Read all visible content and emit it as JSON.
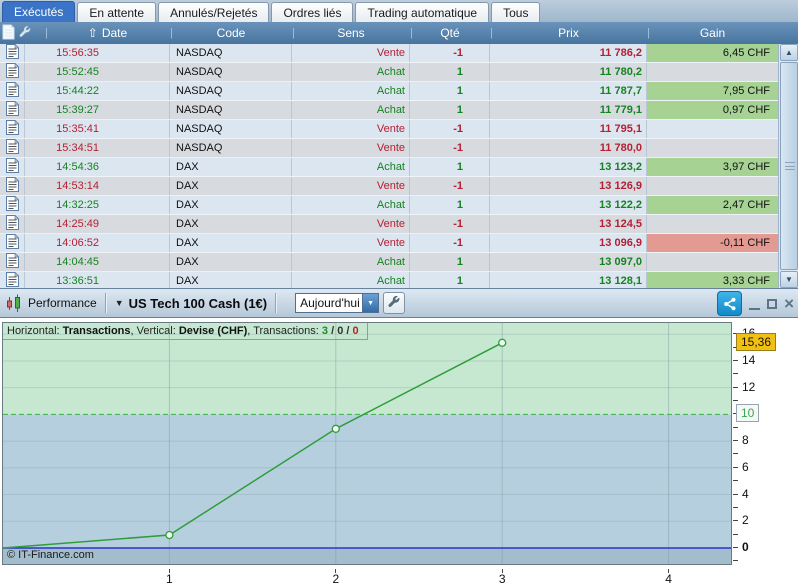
{
  "tabs": [
    {
      "label": "Exécutés",
      "active": true
    },
    {
      "label": "En attente",
      "active": false
    },
    {
      "label": "Annulés/Rejetés",
      "active": false
    },
    {
      "label": "Ordres liés",
      "active": false
    },
    {
      "label": "Trading automatique",
      "active": false
    },
    {
      "label": "Tous",
      "active": false
    }
  ],
  "icons": {
    "sort_asc": "⇧",
    "dropdown_arrow": "▼",
    "instrument_arrow": "▼",
    "scroll_up": "▲",
    "scroll_down": "▼",
    "close_glyph": "×"
  },
  "table": {
    "columns": [
      "Date",
      "Code",
      "Sens",
      "Qté",
      "Prix",
      "Gain"
    ],
    "sorted_column": "Date",
    "sort_direction": "ascending",
    "rows": [
      {
        "time": "15:56:35",
        "code": "NASDAQ",
        "side": "vente",
        "sens": "Vente",
        "qte": "-1",
        "prix": "11 786,2",
        "gain": "6,45 CHF",
        "gain_state": "pos"
      },
      {
        "time": "15:52:45",
        "code": "NASDAQ",
        "side": "achat",
        "sens": "Achat",
        "qte": "1",
        "prix": "11 780,2",
        "gain": "",
        "gain_state": "none"
      },
      {
        "time": "15:44:22",
        "code": "NASDAQ",
        "side": "achat",
        "sens": "Achat",
        "qte": "1",
        "prix": "11 787,7",
        "gain": "7,95 CHF",
        "gain_state": "pos"
      },
      {
        "time": "15:39:27",
        "code": "NASDAQ",
        "side": "achat",
        "sens": "Achat",
        "qte": "1",
        "prix": "11 779,1",
        "gain": "0,97 CHF",
        "gain_state": "pos"
      },
      {
        "time": "15:35:41",
        "code": "NASDAQ",
        "side": "vente",
        "sens": "Vente",
        "qte": "-1",
        "prix": "11 795,1",
        "gain": "",
        "gain_state": "none"
      },
      {
        "time": "15:34:51",
        "code": "NASDAQ",
        "side": "vente",
        "sens": "Vente",
        "qte": "-1",
        "prix": "11 780,0",
        "gain": "",
        "gain_state": "none"
      },
      {
        "time": "14:54:36",
        "code": "DAX",
        "side": "achat",
        "sens": "Achat",
        "qte": "1",
        "prix": "13 123,2",
        "gain": "3,97 CHF",
        "gain_state": "pos"
      },
      {
        "time": "14:53:14",
        "code": "DAX",
        "side": "vente",
        "sens": "Vente",
        "qte": "-1",
        "prix": "13 126,9",
        "gain": "",
        "gain_state": "none"
      },
      {
        "time": "14:32:25",
        "code": "DAX",
        "side": "achat",
        "sens": "Achat",
        "qte": "1",
        "prix": "13 122,2",
        "gain": "2,47 CHF",
        "gain_state": "pos"
      },
      {
        "time": "14:25:49",
        "code": "DAX",
        "side": "vente",
        "sens": "Vente",
        "qte": "-1",
        "prix": "13 124,5",
        "gain": "",
        "gain_state": "none"
      },
      {
        "time": "14:06:52",
        "code": "DAX",
        "side": "vente",
        "sens": "Vente",
        "qte": "-1",
        "prix": "13 096,9",
        "gain": "-0,11 CHF",
        "gain_state": "neg"
      },
      {
        "time": "14:04:45",
        "code": "DAX",
        "side": "achat",
        "sens": "Achat",
        "qte": "1",
        "prix": "13 097,0",
        "gain": "",
        "gain_state": "none"
      },
      {
        "time": "13:36:51",
        "code": "DAX",
        "side": "achat",
        "sens": "Achat",
        "qte": "1",
        "prix": "13 128,1",
        "gain": "3,33 CHF",
        "gain_state": "pos"
      }
    ]
  },
  "panel": {
    "title": "Performance",
    "instrument": "US Tech 100 Cash (1€)",
    "period": "Aujourd'hui"
  },
  "colors": {
    "active_tab": "#3b74c6",
    "header_bg": "#4d7aa6",
    "gain_positive_bg": "#a6d394",
    "gain_negative_bg": "#e29a92",
    "buy_text": "#15831f",
    "sell_text": "#b31f33",
    "share_button": "#128ac8"
  },
  "chart_data": {
    "type": "line",
    "x": [
      1,
      2,
      3
    ],
    "values": [
      0.97,
      8.92,
      15.36
    ],
    "line_origin": {
      "x": 0,
      "y": 0
    },
    "xticks": [
      1,
      2,
      3,
      4
    ],
    "yticks_labeled": [
      0,
      2,
      4,
      6,
      8,
      10,
      12,
      14,
      16
    ],
    "yticks_minor": [
      -1,
      1,
      3,
      5,
      7,
      9,
      11,
      13,
      15
    ],
    "xlim": [
      0,
      4.375
    ],
    "ylim": [
      -1.2,
      16.84
    ],
    "grid": true,
    "threshold_value": 10,
    "threshold_label": "10",
    "last_value": 15.36,
    "last_value_label": "15,36",
    "zero_line_value": 0,
    "legend": {
      "horizontal_label": "Horizontal: ",
      "horizontal_value": "Transactions",
      "comma": ", ",
      "vertical_label": "Vertical: ",
      "vertical_value": "Devise (CHF)",
      "transactions_label": "Transactions: ",
      "wins": "3",
      "slash": " / ",
      "neutral": "0",
      "losses": "0"
    },
    "copyright": "© IT-Finance.com",
    "colors": {
      "zone_above_threshold": "#c6e8d0",
      "zone_mid": "#b6cfdf",
      "zone_below_zero": "#a4bdcc",
      "line": "#2e9e38",
      "marker_fill": "#f2faf4",
      "threshold_line": "#3bb53b",
      "zero_line": "#2936cc",
      "grid": "#7d9aa2",
      "last_value_bg": "#f0c114",
      "threshold_text": "#37a557"
    }
  }
}
